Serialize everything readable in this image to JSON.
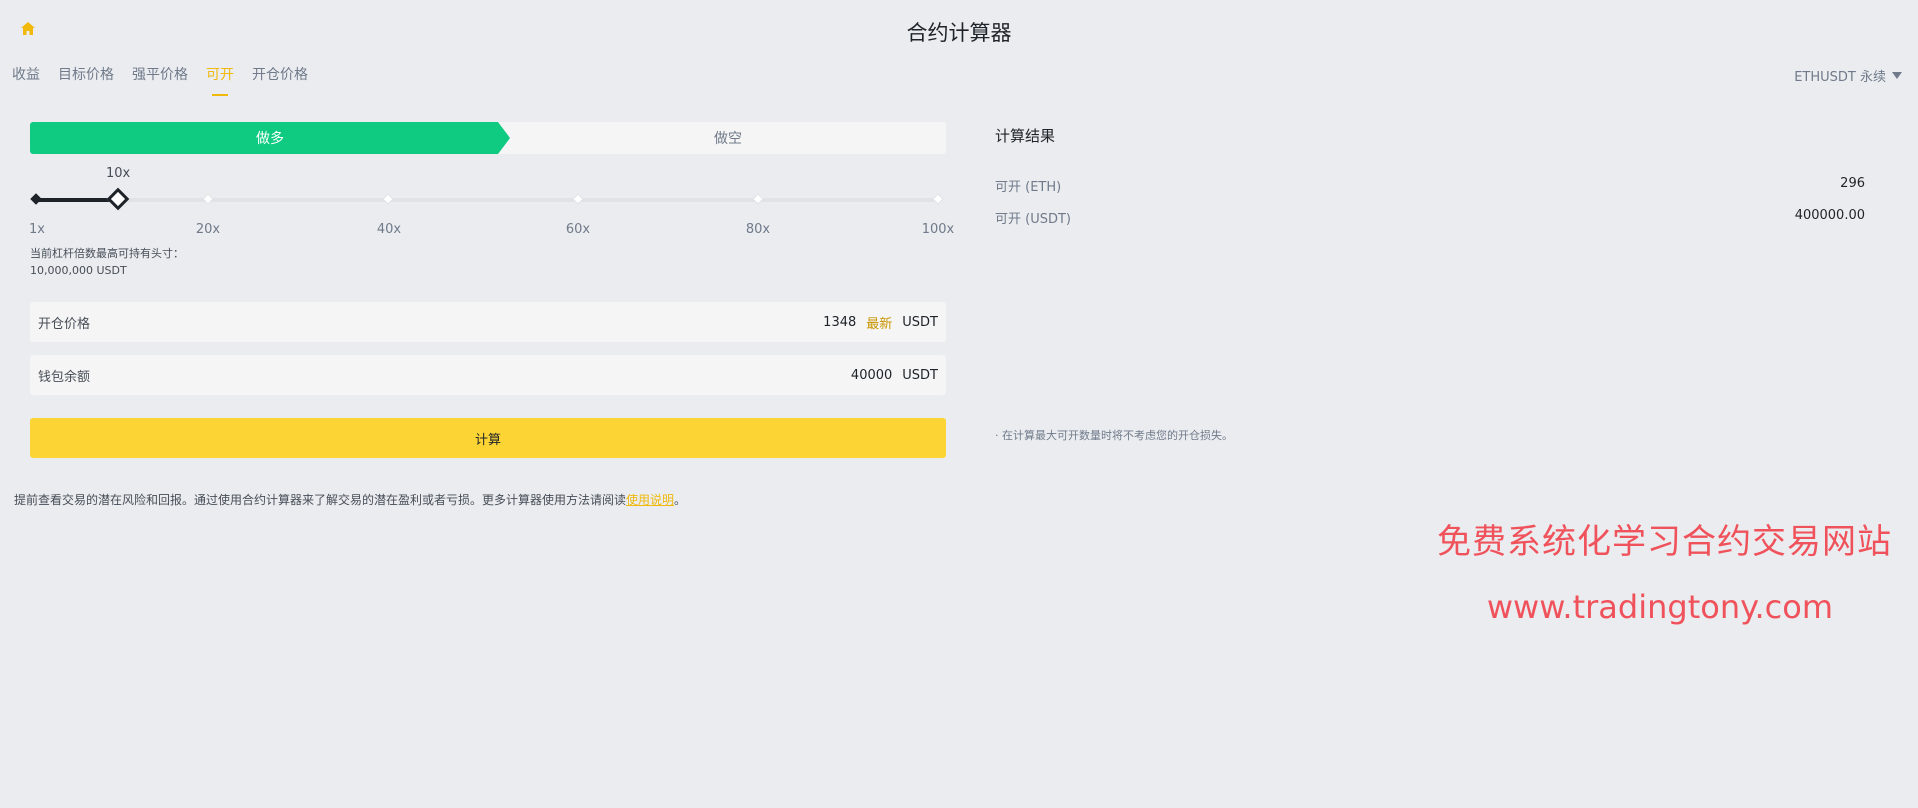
{
  "header": {
    "title": "合约计算器",
    "home_icon": "home-icon",
    "accent_color": "#f0b90b"
  },
  "tabs": [
    {
      "label": "收益",
      "active": false
    },
    {
      "label": "目标价格",
      "active": false
    },
    {
      "label": "强平价格",
      "active": false
    },
    {
      "label": "可开",
      "active": true
    },
    {
      "label": "开仓价格",
      "active": false
    }
  ],
  "symbol": {
    "label": "ETHUSDT 永续",
    "icon": "caret-down-icon"
  },
  "side": {
    "long_label": "做多",
    "short_label": "做空",
    "selected": "long",
    "long_color": "#0ecb81"
  },
  "leverage": {
    "current": "10x",
    "value": 10,
    "min": 1,
    "max": 100,
    "labels": [
      "1x",
      "20x",
      "40x",
      "60x",
      "80x",
      "100x"
    ],
    "note_line1": "当前杠杆倍数最高可持有头寸：",
    "note_line2": "10,000,000 USDT"
  },
  "fields": {
    "open_price": {
      "label": "开仓价格",
      "value": "1348",
      "latest": "最新",
      "unit": "USDT"
    },
    "balance": {
      "label": "钱包余额",
      "value": "40000",
      "unit": "USDT"
    }
  },
  "calculate_label": "计算",
  "footer": {
    "text": "提前查看交易的潜在风险和回报。通过使用合约计算器来了解交易的潜在盈利或者亏损。更多计算器使用方法请阅读",
    "link": "使用说明",
    "end": "。"
  },
  "result": {
    "title": "计算结果",
    "rows": [
      {
        "label": "可开 (ETH)",
        "value": "296"
      },
      {
        "label": "可开 (USDT)",
        "value": "400000.00"
      }
    ],
    "note": "· 在计算最大可开数量时将不考虑您的开仓损失。"
  },
  "watermark": {
    "title": "免费系统化学习合约交易网站",
    "url": "www.tradingtony.com",
    "color": "#f0525b"
  }
}
